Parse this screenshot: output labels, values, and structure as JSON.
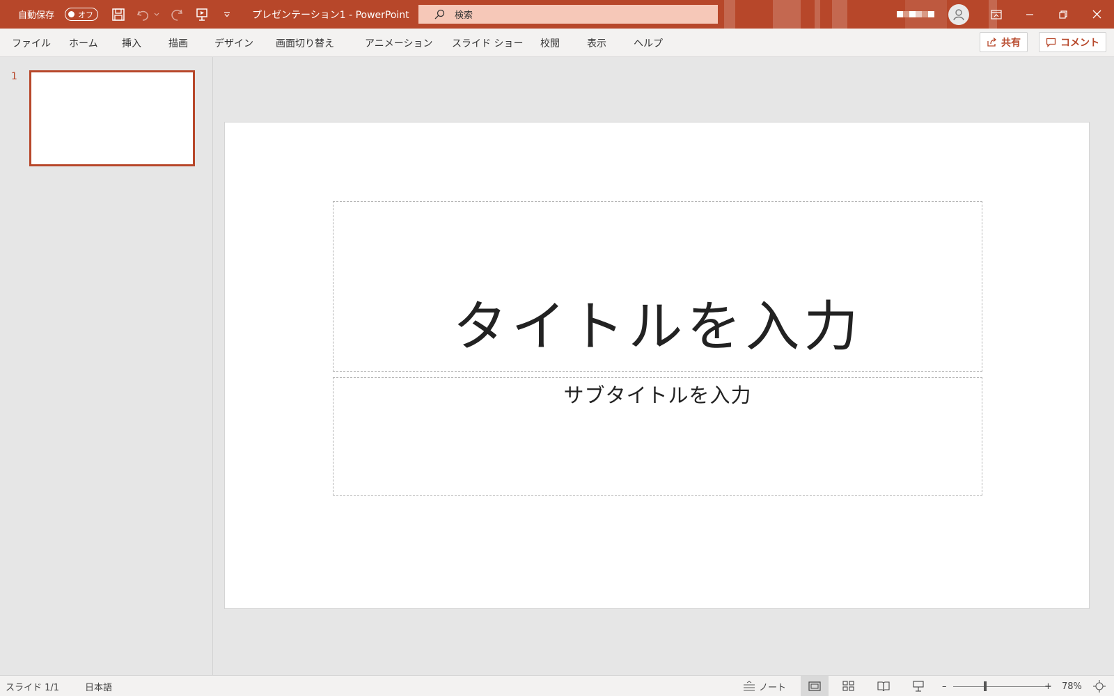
{
  "titlebar": {
    "autosave_label": "自動保存",
    "autosave_state": "オフ",
    "document_title": "プレゼンテーション1  -  PowerPoint",
    "search_placeholder": "検索",
    "accent_color": "#b7472a"
  },
  "ribbon": {
    "tabs": [
      "ファイル",
      "ホーム",
      "挿入",
      "描画",
      "デザイン",
      "画面切り替え",
      "アニメーション",
      "スライド ショー",
      "校閲",
      "表示",
      "ヘルプ"
    ],
    "share_label": "共有",
    "comment_label": "コメント"
  },
  "thumbnails": [
    {
      "number": "1"
    }
  ],
  "slide": {
    "title_placeholder": "タイトルを入力",
    "subtitle_placeholder": "サブタイトルを入力"
  },
  "statusbar": {
    "slide_counter": "スライド 1/1",
    "language": "日本語",
    "notes_label": "ノート",
    "zoom_minus": "–",
    "zoom_plus": "+",
    "zoom_level": "78%"
  }
}
